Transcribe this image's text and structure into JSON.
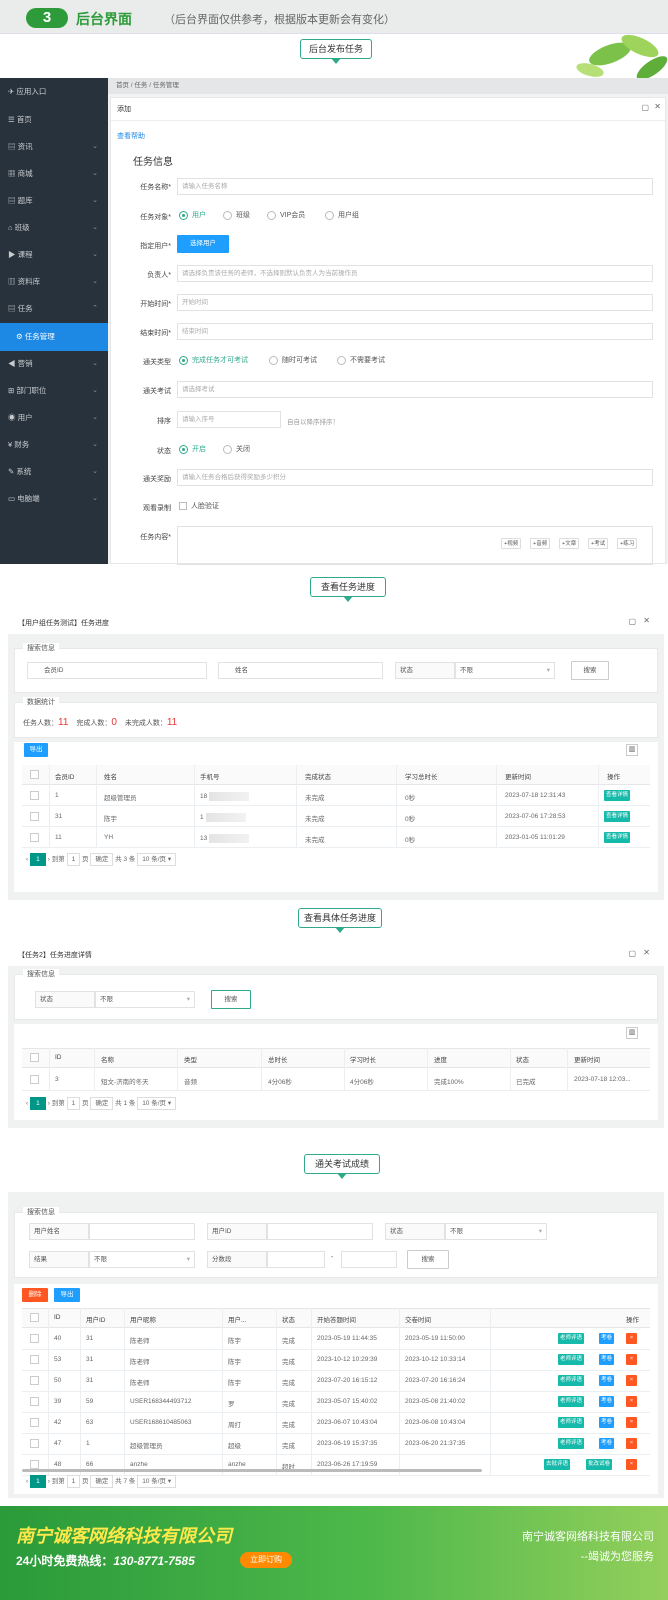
{
  "header": {
    "badge": "3",
    "title": "后台界面",
    "subtitle": "（后台界面仅供参考，根据版本更新会有变化）"
  },
  "callouts": {
    "c1": "后台发布任务",
    "c2": "查看任务进度",
    "c3": "查看具体任务进度",
    "c4": "通关考试成绩"
  },
  "sidebar": {
    "items": [
      {
        "icon": "send-icon",
        "label": "应用入口"
      },
      {
        "icon": "list-icon",
        "label": "首页"
      },
      {
        "icon": "doc-icon",
        "label": "资讯"
      },
      {
        "icon": "grid-icon",
        "label": "商城"
      },
      {
        "icon": "doc-icon",
        "label": "题库"
      },
      {
        "icon": "bank-icon",
        "label": "班级"
      },
      {
        "icon": "video-icon",
        "label": "课程"
      },
      {
        "icon": "folder-icon",
        "label": "资料库"
      },
      {
        "icon": "doc-icon",
        "label": "任务"
      },
      {
        "icon": "gear-icon",
        "label": "任务管理"
      },
      {
        "icon": "megaphone-icon",
        "label": "营销"
      },
      {
        "icon": "sitemap-icon",
        "label": "部门职位"
      },
      {
        "icon": "user-icon",
        "label": "用户"
      },
      {
        "icon": "yen-icon",
        "label": "财务"
      },
      {
        "icon": "wrench-icon",
        "label": "系统"
      },
      {
        "icon": "monitor-icon",
        "label": "电脑端"
      }
    ]
  },
  "s1": {
    "breadcrumb": "首页  /  任务  /  任务管理",
    "window_title": "添加",
    "help_link": "查看帮助",
    "section_title": "任务信息",
    "fields": {
      "name": {
        "label": "任务名称*",
        "placeholder": "请输入任务名称"
      },
      "target": {
        "label": "任务对象*",
        "options": [
          "用户",
          "班级",
          "VIP会员",
          "用户组"
        ]
      },
      "assign": {
        "label": "指定用户*",
        "button": "选择用户"
      },
      "owner": {
        "label": "负责人*",
        "placeholder": "请选择负责该任务的老师，不选择则默认负责人为当前操作员"
      },
      "start": {
        "label": "开始时间*",
        "placeholder": "开始时间"
      },
      "end": {
        "label": "结束时间*",
        "placeholder": "结束时间"
      },
      "pass_type": {
        "label": "通关类型",
        "options": [
          "完成任务才可考试",
          "随时可考试",
          "不需要考试"
        ]
      },
      "exam": {
        "label": "通关考试",
        "placeholder": "请选择考试"
      },
      "sort": {
        "label": "排序",
        "placeholder": "请输入序号",
        "hint": "自自以降序排序！"
      },
      "status": {
        "label": "状态",
        "options": [
          "开启",
          "关闭"
        ]
      },
      "reward": {
        "label": "通关奖励",
        "placeholder": "请输入任务合格后获得奖励多少积分"
      },
      "record": {
        "label": "观看录制",
        "option": "人脸验证"
      },
      "content": {
        "label": "任务内容*",
        "tools": [
          "+视频",
          "+音频",
          "+文章",
          "+考试",
          "+练习"
        ]
      }
    }
  },
  "s2": {
    "window_title": "【用户组任务测试】任务进度",
    "search": {
      "legend": "搜索信息",
      "member_id": "会员ID",
      "name": "姓名",
      "status_label": "状态",
      "status_value": "不限",
      "button": "搜索"
    },
    "stats": {
      "legend": "数据统计",
      "total_label": "任务人数：",
      "total": "11",
      "done_label": "完成人数：",
      "done": "0",
      "undone_label": "未完成人数：",
      "undone": "11"
    },
    "export": "导出",
    "columns": [
      "会员ID",
      "姓名",
      "手机号",
      "完成状态",
      "学习总时长",
      "更新时间",
      "操作"
    ],
    "rows": [
      {
        "id": "1",
        "name": "超级管理员",
        "phone": "18",
        "status": "未完成",
        "dur": "0秒",
        "time": "2023-07-18 12:31:43",
        "op": "查看详情"
      },
      {
        "id": "31",
        "name": "陈宇",
        "phone": "1",
        "status": "未完成",
        "dur": "0秒",
        "time": "2023-07-06 17:28:53",
        "op": "查看详情"
      },
      {
        "id": "11",
        "name": "YH",
        "phone": "13",
        "status": "未完成",
        "dur": "0秒",
        "time": "2023-01-05 11:01:29",
        "op": "查看详情"
      }
    ],
    "pager": {
      "page": "1",
      "goto": "到第",
      "page_input": "1",
      "page_unit": "页",
      "confirm": "确定",
      "total": "共 3 条",
      "size": "10 条/页"
    }
  },
  "s3": {
    "window_title": "【任务2】任务进度详情",
    "search": {
      "legend": "搜索信息",
      "status_label": "状态",
      "status_value": "不限",
      "button": "搜索"
    },
    "columns": [
      "ID",
      "名称",
      "类型",
      "总时长",
      "学习时长",
      "进度",
      "状态",
      "更新时间"
    ],
    "rows": [
      {
        "id": "3",
        "name": "短文-济南的冬天",
        "type": "音频",
        "total": "4分06秒",
        "learned": "4分06秒",
        "progress": "完成100%",
        "status": "已完成",
        "time": "2023-07-18 12:03..."
      }
    ],
    "pager": {
      "page": "1",
      "goto": "到第",
      "page_input": "1",
      "page_unit": "页",
      "confirm": "确定",
      "total": "共 1 条",
      "size": "10 条/页"
    }
  },
  "s4": {
    "search": {
      "legend": "搜索信息",
      "username": "用户姓名",
      "userid": "用户ID",
      "status_label": "状态",
      "status_value": "不限",
      "result_label": "结果",
      "result_value": "不限",
      "score_label": "分数段",
      "dash": "-",
      "button": "搜索"
    },
    "delete": "删除",
    "export": "导出",
    "columns": [
      "ID",
      "用户ID",
      "用户昵称",
      "用户...",
      "状态",
      "开始答题时间",
      "交卷时间",
      "操作"
    ],
    "rows": [
      {
        "id": "40",
        "uid": "31",
        "nick": "陈老师",
        "real": "陈宇",
        "status": "完成",
        "start": "2023-05-19 11:44:35",
        "end": "2023-05-19 11:50:00"
      },
      {
        "id": "53",
        "uid": "31",
        "nick": "陈老师",
        "real": "陈宇",
        "status": "完成",
        "start": "2023-10-12 10:29:39",
        "end": "2023-10-12 10:33:14"
      },
      {
        "id": "50",
        "uid": "31",
        "nick": "陈老师",
        "real": "陈宇",
        "status": "完成",
        "start": "2023-07-20 16:15:12",
        "end": "2023-07-20 16:16:24"
      },
      {
        "id": "39",
        "uid": "59",
        "nick": "USER168344493712",
        "real": "罗",
        "status": "完成",
        "start": "2023-05-07 15:40:02",
        "end": "2023-05-08 21:40:02"
      },
      {
        "id": "42",
        "uid": "63",
        "nick": "USER168610485063",
        "real": "周打",
        "status": "完成",
        "start": "2023-06-07 10:43:04",
        "end": "2023-06-08 10:43:04"
      },
      {
        "id": "47",
        "uid": "1",
        "nick": "超级管理员",
        "real": "超级",
        "status": "完成",
        "start": "2023-06-19 15:37:35",
        "end": "2023-06-20 21:37:35"
      },
      {
        "id": "48",
        "uid": "66",
        "nick": "anzhe",
        "real": "anzhe",
        "status": "超时",
        "start": "2023-06-26 17:19:59",
        "end": ""
      }
    ],
    "ops": {
      "review": "老师评语",
      "review2": "去批评语",
      "exam": "考卷",
      "exam2": "批改试卷",
      "del": "×"
    },
    "pager": {
      "page": "1",
      "goto": "到第",
      "page_input": "1",
      "page_unit": "页",
      "confirm": "确定",
      "total": "共 7 条",
      "size": "10 条/页"
    }
  },
  "footer": {
    "company": "南宁诚客网络科技有限公司",
    "hotline_label": "24小时免费热线：",
    "hotline": "130-8771-7585",
    "cta": "立即订购",
    "right_company": "南宁诚客网络科技有限公司",
    "slogan": "--竭诚为您服务"
  }
}
